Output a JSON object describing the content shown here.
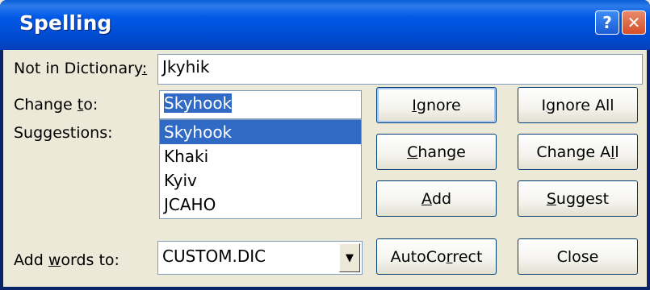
{
  "window": {
    "title": "Spelling",
    "help_button": "?",
    "close_button": "✕"
  },
  "not_in_dictionary": {
    "label_pre": "Not in Dictionary",
    "label_u": ":",
    "value": "Jkyhik"
  },
  "change_to": {
    "label_pre": "Change ",
    "label_u": "t",
    "label_post": "o:",
    "value": "Skyhook"
  },
  "suggestions": {
    "label": "Suggestions:",
    "items": [
      "Skyhook",
      "Khaki",
      "Kyiv",
      "JCAHO"
    ],
    "selected_index": 0
  },
  "add_words_to": {
    "label_pre": "Add ",
    "label_u": "w",
    "label_post": "ords to:",
    "value": "CUSTOM.DIC"
  },
  "buttons": {
    "ignore": {
      "pre": "",
      "u": "I",
      "post": "gnore"
    },
    "ignore_all": {
      "pre": "I",
      "u": "g",
      "post": "nore All"
    },
    "change": {
      "pre": "",
      "u": "C",
      "post": "hange"
    },
    "change_all": {
      "pre": "Change A",
      "u": "l",
      "post": "l"
    },
    "add": {
      "pre": "",
      "u": "A",
      "post": "dd"
    },
    "suggest": {
      "pre": "",
      "u": "S",
      "post": "uggest"
    },
    "autocorrect": {
      "pre": "AutoCo",
      "u": "r",
      "post": "rect"
    },
    "close": {
      "pre": "Close",
      "u": "",
      "post": ""
    }
  }
}
